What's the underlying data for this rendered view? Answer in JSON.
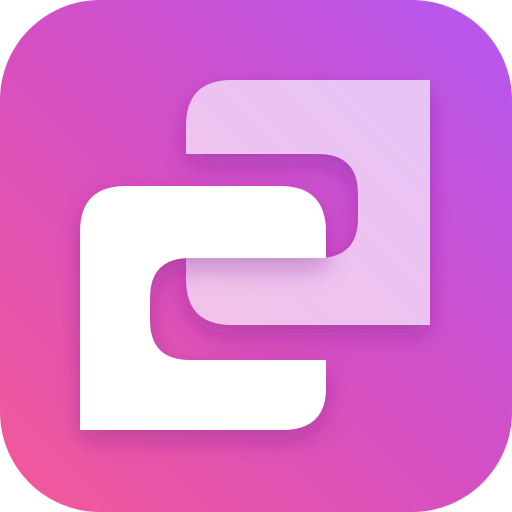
{
  "app_icon": {
    "icon": "overlapping-frames-icon",
    "colors": {
      "gradient_start": "#f45a97",
      "gradient_mid": "#d64fc2",
      "gradient_end": "#b558f2",
      "front_frame": "#ffffff",
      "back_frame_light": "#f3c8ee",
      "back_frame_lilac": "#e8c2f5"
    }
  }
}
